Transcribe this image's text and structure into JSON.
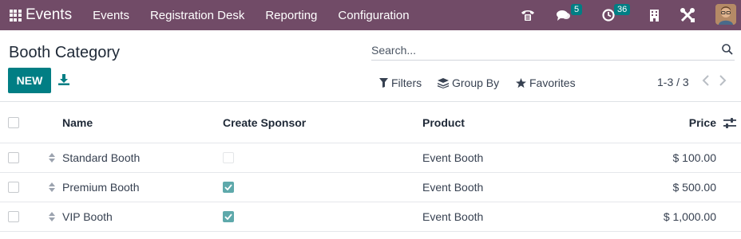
{
  "navbar": {
    "app_name": "Events",
    "menu": [
      "Events",
      "Registration Desk",
      "Reporting",
      "Configuration"
    ],
    "messages_badge": "5",
    "activities_badge": "36",
    "brand_color": "#714b67"
  },
  "control_panel": {
    "breadcrumb": "Booth Category",
    "new_label": "NEW",
    "search_placeholder": "Search...",
    "filters_label": "Filters",
    "group_by_label": "Group By",
    "favorites_label": "Favorites",
    "pager": "1-3 / 3",
    "accent_color": "#017e84"
  },
  "table": {
    "columns": {
      "name": "Name",
      "create_sponsor": "Create Sponsor",
      "product": "Product",
      "price": "Price"
    },
    "rows": [
      {
        "name": "Standard Booth",
        "create_sponsor": false,
        "product": "Event Booth",
        "price": "$ 100.00"
      },
      {
        "name": "Premium Booth",
        "create_sponsor": true,
        "product": "Event Booth",
        "price": "$ 500.00"
      },
      {
        "name": "VIP Booth",
        "create_sponsor": true,
        "product": "Event Booth",
        "price": "$ 1,000.00"
      }
    ]
  }
}
